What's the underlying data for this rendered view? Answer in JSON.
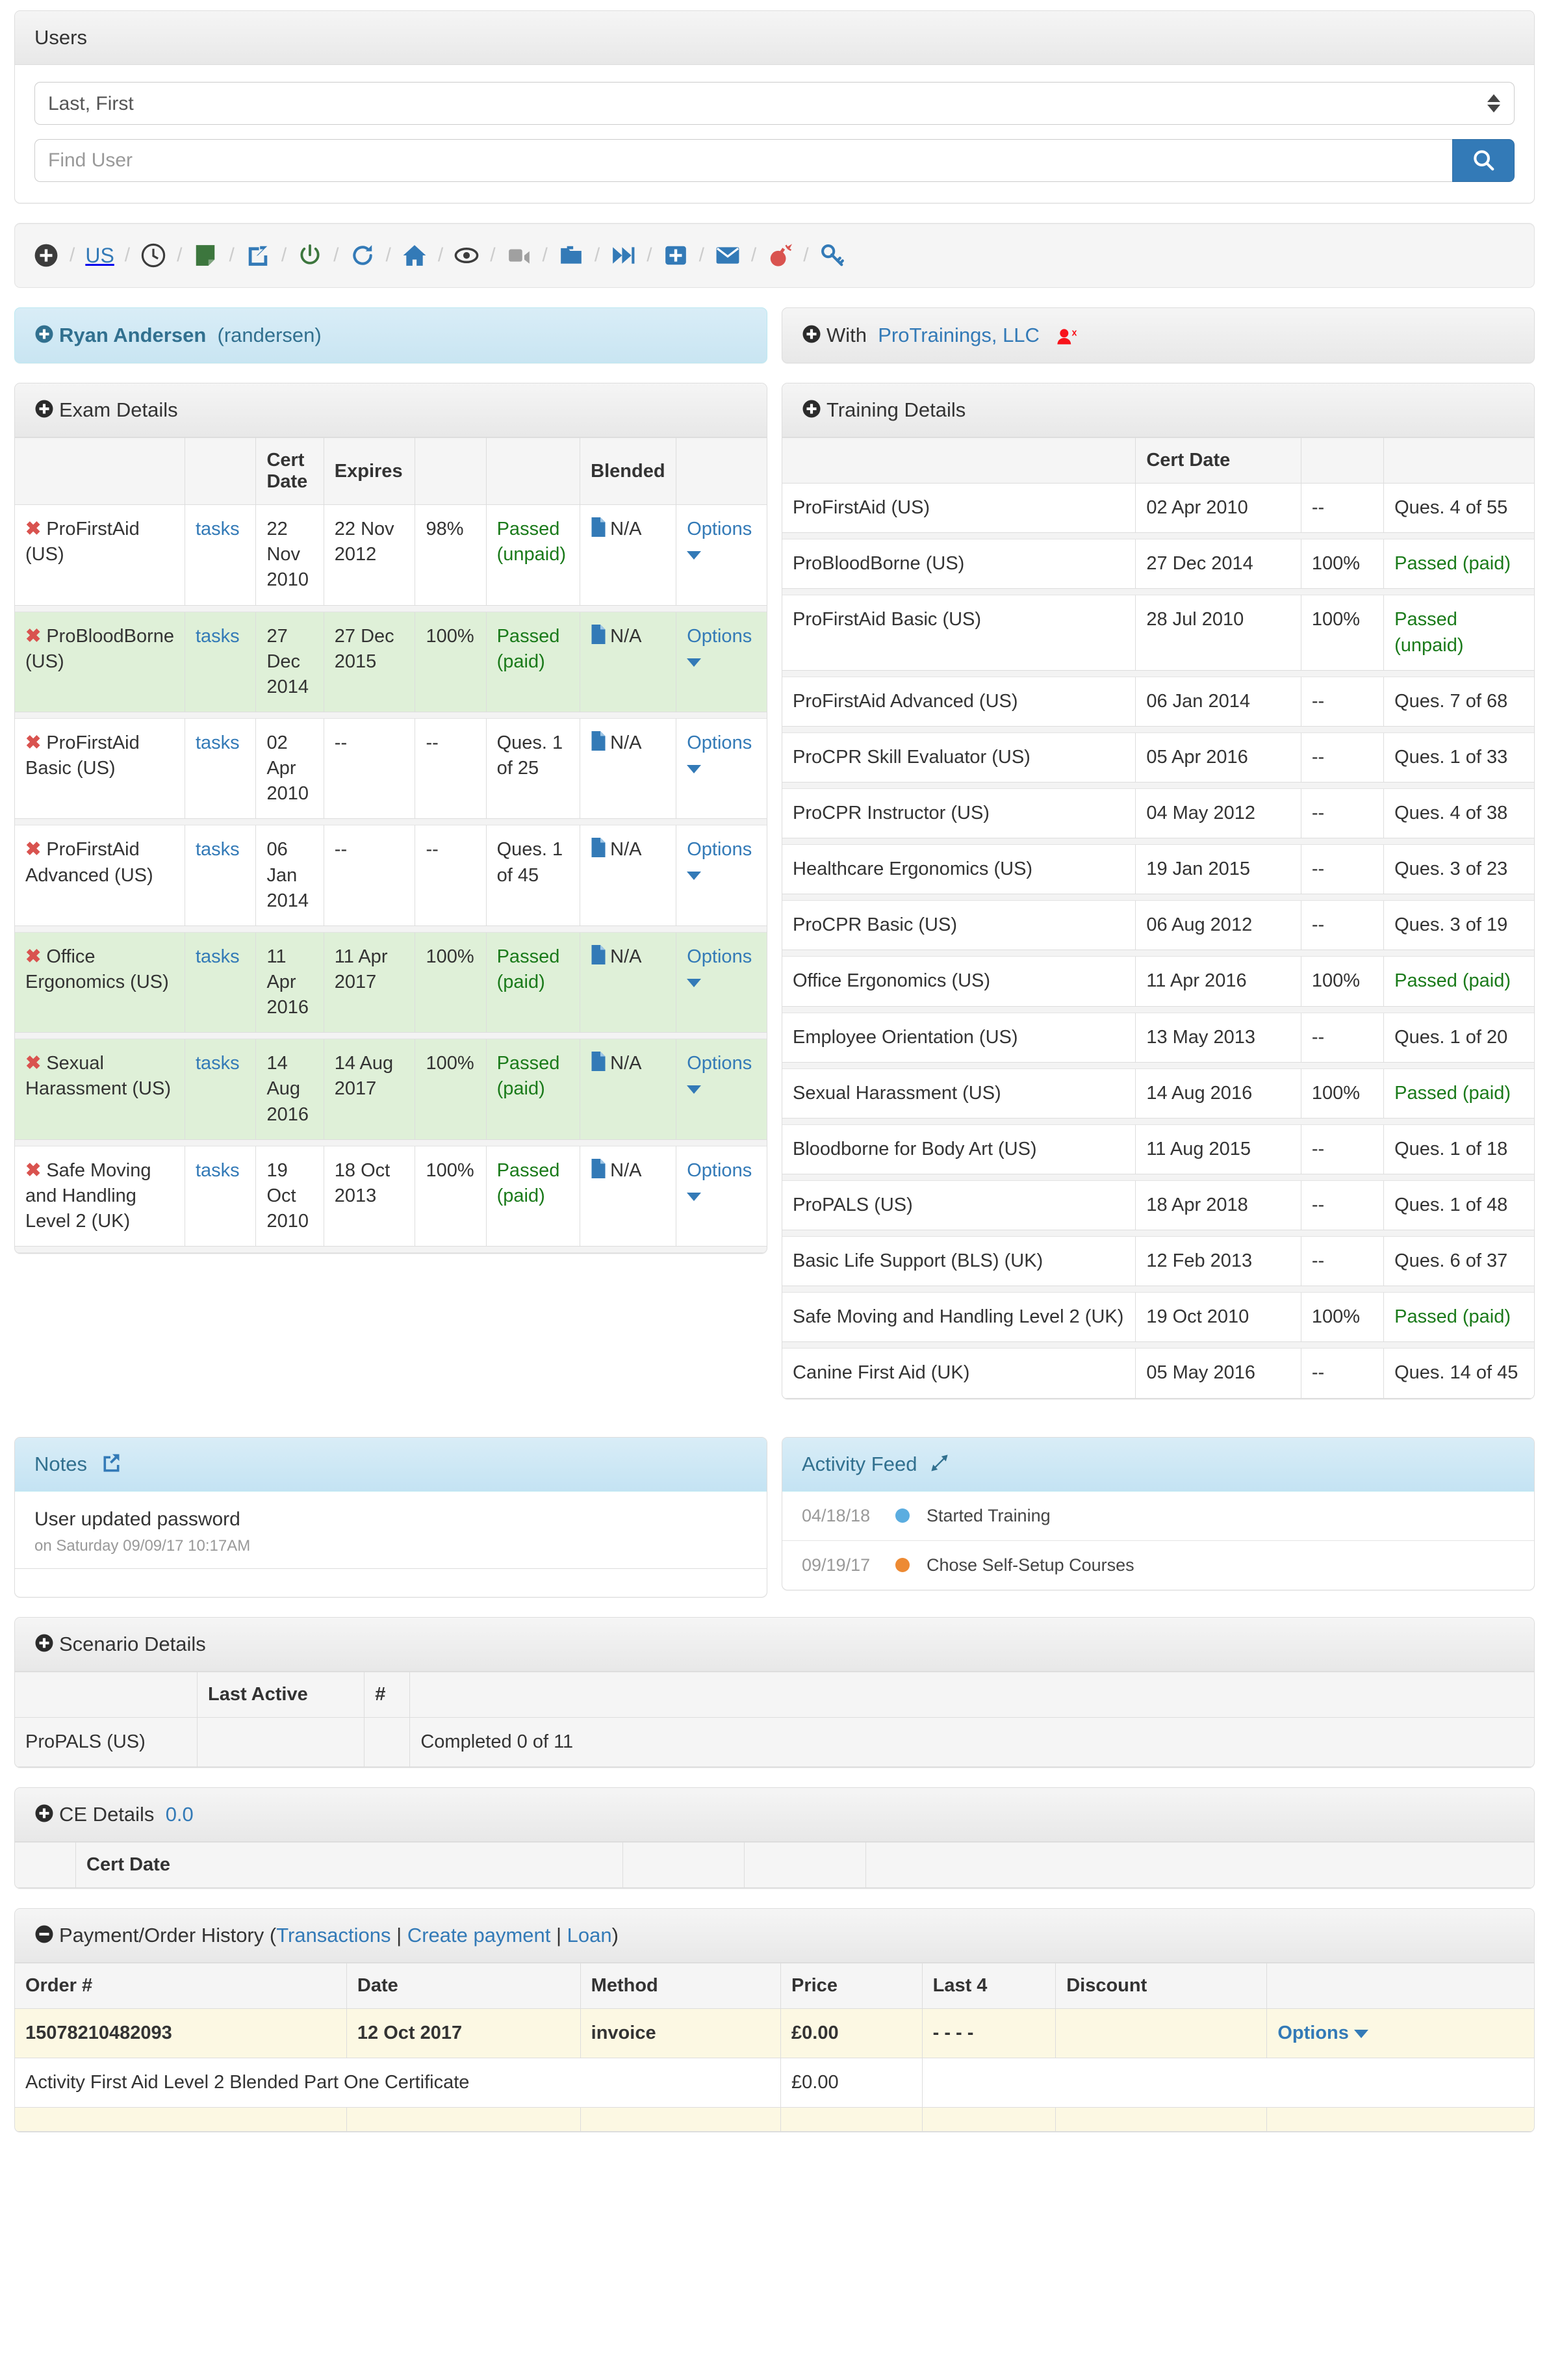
{
  "users_card": {
    "title": "Users",
    "sort_select": {
      "value": "Last, First",
      "options": [
        "Last, First"
      ]
    },
    "find_input": {
      "value": "",
      "placeholder": "Find User"
    },
    "search_button_icon": "search-icon"
  },
  "toolbar": {
    "items": [
      {
        "name": "add-icon",
        "type": "icon",
        "kind": "plus-circle",
        "color": "#3c3c3c"
      },
      {
        "name": "region-us-link",
        "type": "text",
        "label": "US",
        "color": "#337ab7"
      },
      {
        "name": "history-icon",
        "type": "icon",
        "kind": "clock",
        "color": "#3c3c3c"
      },
      {
        "name": "note-icon",
        "type": "icon",
        "kind": "note",
        "color": "#3c763d"
      },
      {
        "name": "share-icon",
        "type": "icon",
        "kind": "share",
        "color": "#337ab7"
      },
      {
        "name": "power-icon",
        "type": "icon",
        "kind": "power",
        "color": "#3c763d"
      },
      {
        "name": "refresh-icon",
        "type": "icon",
        "kind": "refresh",
        "color": "#337ab7"
      },
      {
        "name": "home-icon",
        "type": "icon",
        "kind": "home",
        "color": "#337ab7"
      },
      {
        "name": "eye-icon",
        "type": "icon",
        "kind": "eye",
        "color": "#3c3c3c"
      },
      {
        "name": "video-icon",
        "type": "icon",
        "kind": "video",
        "color": "#a0a0a0"
      },
      {
        "name": "folder-icon",
        "type": "icon",
        "kind": "folder",
        "color": "#337ab7"
      },
      {
        "name": "forward-icon",
        "type": "icon",
        "kind": "forward",
        "color": "#337ab7"
      },
      {
        "name": "add-box-icon",
        "type": "icon",
        "kind": "plus-square",
        "color": "#337ab7"
      },
      {
        "name": "mail-icon",
        "type": "icon",
        "kind": "envelope",
        "color": "#337ab7"
      },
      {
        "name": "alert-icon",
        "type": "icon",
        "kind": "bomb",
        "color": "#d9534f"
      },
      {
        "name": "key-icon",
        "type": "icon",
        "kind": "key",
        "color": "#337ab7"
      }
    ],
    "separator": "/"
  },
  "user_header": {
    "name": "Ryan Andersen",
    "username": "(randersen)"
  },
  "org_header": {
    "prefix": "With",
    "org": "ProTrainings, LLC",
    "remove_icon": "user-remove-icon"
  },
  "exam_details": {
    "title": "Exam Details",
    "columns": [
      "",
      "",
      "Cert Date",
      "Expires",
      "",
      "",
      "Blended",
      ""
    ],
    "rows": [
      {
        "highlight": "white",
        "course": "ProFirstAid (US)",
        "tasks": "tasks",
        "cert_date": "22 Nov 2010",
        "expires": "22 Nov 2012",
        "score": "98%",
        "status": "Passed (unpaid)",
        "status_type": "pass",
        "blended": "N/A",
        "options": "Options"
      },
      {
        "highlight": "green",
        "course": "ProBloodBorne (US)",
        "tasks": "tasks",
        "cert_date": "27 Dec 2014",
        "expires": "27 Dec 2015",
        "score": "100%",
        "status": "Passed (paid)",
        "status_type": "pass",
        "blended": "N/A",
        "options": "Options"
      },
      {
        "highlight": "white",
        "course": "ProFirstAid Basic (US)",
        "tasks": "tasks",
        "cert_date": "02 Apr 2010",
        "expires": "--",
        "score": "--",
        "status": "Ques. 1 of 25",
        "status_type": "plain",
        "blended": "N/A",
        "options": "Options"
      },
      {
        "highlight": "white",
        "course": "ProFirstAid Advanced (US)",
        "tasks": "tasks",
        "cert_date": "06 Jan 2014",
        "expires": "--",
        "score": "--",
        "status": "Ques. 1 of 45",
        "status_type": "plain",
        "blended": "N/A",
        "options": "Options"
      },
      {
        "highlight": "green",
        "course": "Office Ergonomics (US)",
        "tasks": "tasks",
        "cert_date": "11 Apr 2016",
        "expires": "11 Apr 2017",
        "score": "100%",
        "status": "Passed (paid)",
        "status_type": "pass",
        "blended": "N/A",
        "options": "Options"
      },
      {
        "highlight": "green",
        "course": "Sexual Harassment (US)",
        "tasks": "tasks",
        "cert_date": "14 Aug 2016",
        "expires": "14 Aug 2017",
        "score": "100%",
        "status": "Passed (paid)",
        "status_type": "pass",
        "blended": "N/A",
        "options": "Options"
      },
      {
        "highlight": "white",
        "course": "Safe Moving and Handling Level 2 (UK)",
        "tasks": "tasks",
        "cert_date": "19 Oct 2010",
        "expires": "18 Oct 2013",
        "score": "100%",
        "status": "Passed (paid)",
        "status_type": "pass",
        "blended": "N/A",
        "options": "Options"
      }
    ]
  },
  "training_details": {
    "title": "Training Details",
    "columns": [
      "",
      "Cert Date",
      "",
      ""
    ],
    "rows": [
      {
        "course": "ProFirstAid (US)",
        "cert_date": "02 Apr 2010",
        "score": "--",
        "status": "Ques. 4 of 55",
        "status_type": "plain"
      },
      {
        "course": "ProBloodBorne (US)",
        "cert_date": "27 Dec 2014",
        "score": "100%",
        "status": "Passed (paid)",
        "status_type": "pass"
      },
      {
        "course": "ProFirstAid Basic (US)",
        "cert_date": "28 Jul 2010",
        "score": "100%",
        "status": "Passed (unpaid)",
        "status_type": "pass"
      },
      {
        "course": "ProFirstAid Advanced (US)",
        "cert_date": "06 Jan 2014",
        "score": "--",
        "status": "Ques. 7 of 68",
        "status_type": "plain"
      },
      {
        "course": "ProCPR Skill Evaluator (US)",
        "cert_date": "05 Apr 2016",
        "score": "--",
        "status": "Ques. 1 of 33",
        "status_type": "plain"
      },
      {
        "course": "ProCPR Instructor (US)",
        "cert_date": "04 May 2012",
        "score": "--",
        "status": "Ques. 4 of 38",
        "status_type": "plain"
      },
      {
        "course": "Healthcare Ergonomics (US)",
        "cert_date": "19 Jan 2015",
        "score": "--",
        "status": "Ques. 3 of 23",
        "status_type": "plain"
      },
      {
        "course": "ProCPR Basic (US)",
        "cert_date": "06 Aug 2012",
        "score": "--",
        "status": "Ques. 3 of 19",
        "status_type": "plain"
      },
      {
        "course": "Office Ergonomics (US)",
        "cert_date": "11 Apr 2016",
        "score": "100%",
        "status": "Passed (paid)",
        "status_type": "pass"
      },
      {
        "course": "Employee Orientation (US)",
        "cert_date": "13 May 2013",
        "score": "--",
        "status": "Ques. 1 of 20",
        "status_type": "plain"
      },
      {
        "course": "Sexual Harassment (US)",
        "cert_date": "14 Aug 2016",
        "score": "100%",
        "status": "Passed (paid)",
        "status_type": "pass"
      },
      {
        "course": "Bloodborne for Body Art (US)",
        "cert_date": "11 Aug 2015",
        "score": "--",
        "status": "Ques. 1 of 18",
        "status_type": "plain"
      },
      {
        "course": "ProPALS (US)",
        "cert_date": "18 Apr 2018",
        "score": "--",
        "status": "Ques. 1 of 48",
        "status_type": "plain"
      },
      {
        "course": "Basic Life Support (BLS) (UK)",
        "cert_date": "12 Feb 2013",
        "score": "--",
        "status": "Ques. 6 of 37",
        "status_type": "plain"
      },
      {
        "course": "Safe Moving and Handling Level 2 (UK)",
        "cert_date": "19 Oct 2010",
        "score": "100%",
        "status": "Passed (paid)",
        "status_type": "pass"
      },
      {
        "course": "Canine First Aid (UK)",
        "cert_date": "05 May 2016",
        "score": "--",
        "status": "Ques. 14 of 45",
        "status_type": "plain"
      }
    ]
  },
  "notes": {
    "title": "Notes",
    "expand_icon": "external-link-icon",
    "items": [
      {
        "text": "User updated password",
        "meta": "on Saturday 09/09/17 10:17AM"
      }
    ]
  },
  "activity_feed": {
    "title": "Activity Feed",
    "expand_icon": "expand-arrows-icon",
    "items": [
      {
        "date": "04/18/18",
        "dot_color": "#5bade0",
        "text": "Started Training"
      },
      {
        "date": "09/19/17",
        "dot_color": "#ed8a33",
        "text": "Chose Self-Setup Courses"
      }
    ]
  },
  "scenario_details": {
    "title": "Scenario Details",
    "columns": [
      "",
      "Last Active",
      "#",
      ""
    ],
    "rows": [
      {
        "course": "ProPALS (US)",
        "last_active": "",
        "count": "",
        "progress": "Completed 0 of 11"
      }
    ]
  },
  "ce_details": {
    "title": "CE Details",
    "value": "0.0",
    "columns": [
      "",
      "Cert Date",
      "",
      "",
      ""
    ],
    "rows": []
  },
  "payment_history": {
    "title": "Payment/Order History",
    "links": [
      "Transactions",
      "Create payment",
      "Loan"
    ],
    "columns": [
      "Order #",
      "Date",
      "Method",
      "Price",
      "Last 4",
      "Discount",
      ""
    ],
    "rows": [
      {
        "type": "order",
        "order": "15078210482093",
        "date": "12 Oct 2017",
        "method": "invoice",
        "price": "£0.00",
        "last4": "- - - -",
        "discount": "",
        "options": "Options"
      },
      {
        "type": "item",
        "desc": "Activity First Aid Level 2 Blended Part One Certificate",
        "price": "£0.00"
      },
      {
        "type": "order",
        "order": "",
        "date": "",
        "method": "",
        "price": "",
        "last4": "",
        "discount": "",
        "options": ""
      }
    ]
  }
}
